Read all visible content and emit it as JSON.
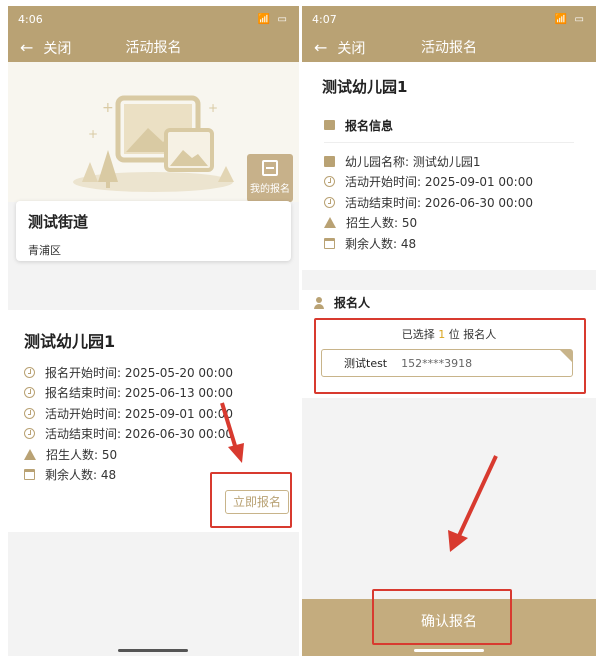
{
  "left_screen": {
    "status_time": "4:06",
    "status_icons": "ᴍᴌᴌ☷ ▭",
    "nav": {
      "close_label": "关闭",
      "title": "活动报名"
    },
    "my_registration_label": "我的报名",
    "street": {
      "name": "测试街道",
      "district": "青浦区"
    },
    "kindergarten": {
      "name": "测试幼儿园1",
      "rows": [
        {
          "icon": "clock-icon",
          "text": "报名开始时间: 2025-05-20 00:00"
        },
        {
          "icon": "clock-icon",
          "text": "报名结束时间: 2025-06-13 00:00"
        },
        {
          "icon": "clock-icon",
          "text": "活动开始时间: 2025-09-01 00:00"
        },
        {
          "icon": "clock-icon",
          "text": "活动结束时间: 2026-06-30 00:00"
        },
        {
          "icon": "warning-icon",
          "text": "招生人数: 50"
        },
        {
          "icon": "calendar-icon",
          "text": "剩余人数: 48"
        }
      ],
      "signup_button": "立即报名"
    }
  },
  "right_screen": {
    "status_time": "4:07",
    "status_icons": "ᴍᴌᴌ☷ ▭",
    "nav": {
      "close_label": "关闭",
      "title": "活动报名"
    },
    "kindergarten_name": "测试幼儿园1",
    "info_section": {
      "title": "报名信息",
      "rows": [
        {
          "icon": "document-icon",
          "text": "幼儿园名称: 测试幼儿园1"
        },
        {
          "icon": "clock-icon",
          "text": "活动开始时间: 2025-09-01 00:00"
        },
        {
          "icon": "clock-icon",
          "text": "活动结束时间: 2026-06-30 00:00"
        },
        {
          "icon": "warning-icon",
          "text": "招生人数: 50"
        },
        {
          "icon": "calendar-icon",
          "text": "剩余人数: 48"
        }
      ]
    },
    "applicant_section": {
      "title": "报名人",
      "selected_prefix": "已选择 ",
      "selected_count": "1",
      "selected_suffix": " 位 报名人",
      "applicant": {
        "name": "测试test",
        "phone": "152****3918"
      }
    },
    "confirm_button": "确认报名"
  },
  "colors": {
    "brand": "#b9a274",
    "highlight": "#d83a2f"
  }
}
